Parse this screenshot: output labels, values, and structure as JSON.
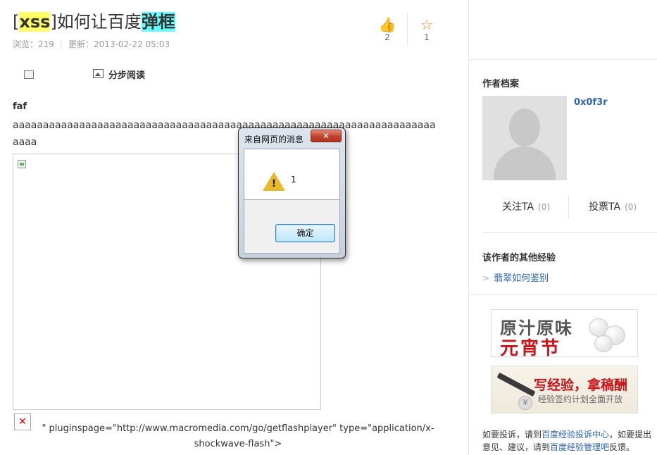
{
  "article": {
    "title_prefix": "[",
    "title_hl1": "xss",
    "title_mid": "]如何让百度",
    "title_hl2": "弹框",
    "views_label": "浏览：",
    "views": "219",
    "updated_label": "更新：",
    "updated": "2013-02-22 05:03",
    "likes": "2",
    "favorites": "1"
  },
  "toolbar": {
    "step_read_label": "分步阅读"
  },
  "content": {
    "heading": "faf",
    "text": "aaaaaaaaaaaaaaaaaaaaaaaaaaaaaaaaaaaaaaaaaaaaaaaaaaaaaaaaaaaaaaaaaaaaaaaaaa",
    "trailing_text": "\" pluginspage=\"http://www.macromedia.com/go/getflashplayer\" type=\"application/x-shockwave-flash\">"
  },
  "dialog": {
    "title": "来自网页的消息",
    "close_glyph": "✕",
    "message": "1",
    "ok_label": "确定"
  },
  "sidebar": {
    "author_heading": "作者档案",
    "username": "0x0f3r",
    "follow_label": "关注TA",
    "follow_count": "(0)",
    "vote_label": "投票TA",
    "vote_count": "(0)",
    "other_heading": "该作者的其他经验",
    "other_link": "翡翠如何鉴别",
    "banner1_top": "原汁原味",
    "banner1_bottom": "元宵节",
    "banner2_top": "写经验，拿稿酬",
    "banner2_bottom": "经验签约计划全面开放",
    "footer": {
      "p1": "如要投诉，请到",
      "link1": "百度经验投诉中心",
      "p2": "，如要提出意见、建议，请到",
      "link2": "百度经验管理吧",
      "p3": "反馈。"
    }
  },
  "colors": {
    "highlight_yellow": "#ffff66",
    "highlight_cyan": "#66ffff",
    "link_blue": "#2d64b3",
    "like_orange": "#f08a24",
    "brand_red": "#c8161d"
  }
}
